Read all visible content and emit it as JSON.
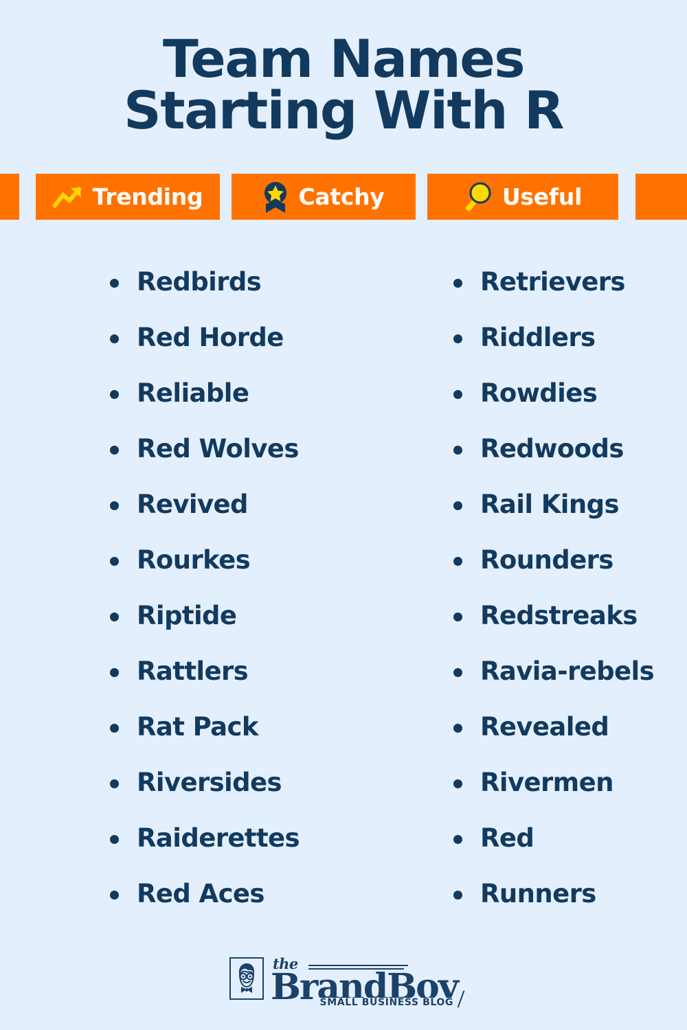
{
  "theme": {
    "background": "#e4effd",
    "navy": "#123a5e",
    "orange": "#ff7200",
    "yellow": "#ffd800",
    "white": "#ffffff"
  },
  "header": {
    "title_line_1": "Team Names",
    "title_line_2": "Starting With R"
  },
  "badges": [
    {
      "label": "Trending",
      "icon": "trending-up-icon"
    },
    {
      "label": "Catchy",
      "icon": "award-ribbon-icon"
    },
    {
      "label": "Useful",
      "icon": "magnifying-glass-icon"
    }
  ],
  "list": {
    "left_column": [
      "Redbirds",
      "Red Horde",
      "Reliable",
      "Red Wolves",
      "Revived",
      "Rourkes",
      "Riptide",
      "Rattlers",
      "Rat Pack",
      "Riversides",
      "Raiderettes",
      "Red Aces"
    ],
    "right_column": [
      "Retrievers",
      "Riddlers",
      "Rowdies",
      "Redwoods",
      "Rail Kings",
      "Rounders",
      "Redstreaks",
      "Ravia-rebels",
      "Revealed",
      "Rivermen",
      "Red",
      "Runners"
    ]
  },
  "footer": {
    "logo_the": "the",
    "logo_brand": "BrandBoy",
    "logo_tagline": "SMALL BUSINESS BLOG",
    "logo_mark_icon": "boy-face-icon"
  }
}
